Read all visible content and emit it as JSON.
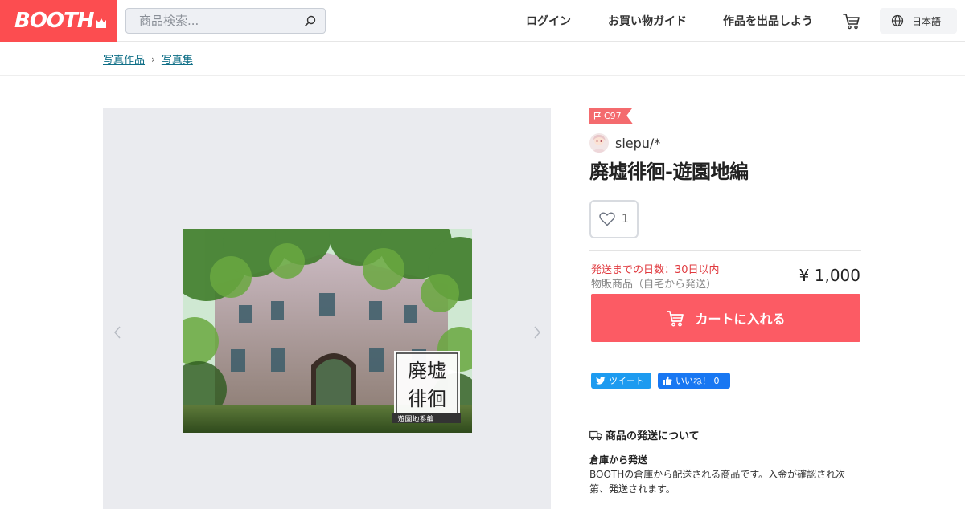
{
  "header": {
    "logo": "BOOTH",
    "search_placeholder": "商品検索...",
    "nav": {
      "login": "ログイン",
      "guide": "お買い物ガイド",
      "sell": "作品を出品しよう"
    },
    "language": "日本語"
  },
  "breadcrumb": [
    "写真作品",
    "写真集"
  ],
  "product": {
    "event_tag": "C97",
    "shop_name": "siepu/*",
    "title": "廃墟徘徊-遊園地編",
    "like_count": "1",
    "shipping_days": "発送までの日数：30日以内",
    "shipping_type": "物販商品（自宅から発送）",
    "price": "¥ 1,000",
    "cart_button": "カートに入れる",
    "cover_text": {
      "big": [
        "廃",
        "墟",
        "徘",
        "徊"
      ],
      "small": "遊園地系編"
    }
  },
  "social": {
    "tweet": "ツイート",
    "like": "いいね！ 0"
  },
  "shipping_info": {
    "heading": "商品の発送について",
    "warehouse_title": "倉庫から発送",
    "warehouse_desc": "BOOTHの倉庫から配送される商品です。入金が確認され次第、発送されます。"
  },
  "colors": {
    "brand": "#fc4d50",
    "cart_button": "#fc5b64",
    "link": "#0e6e86",
    "warning": "#e0393e"
  }
}
